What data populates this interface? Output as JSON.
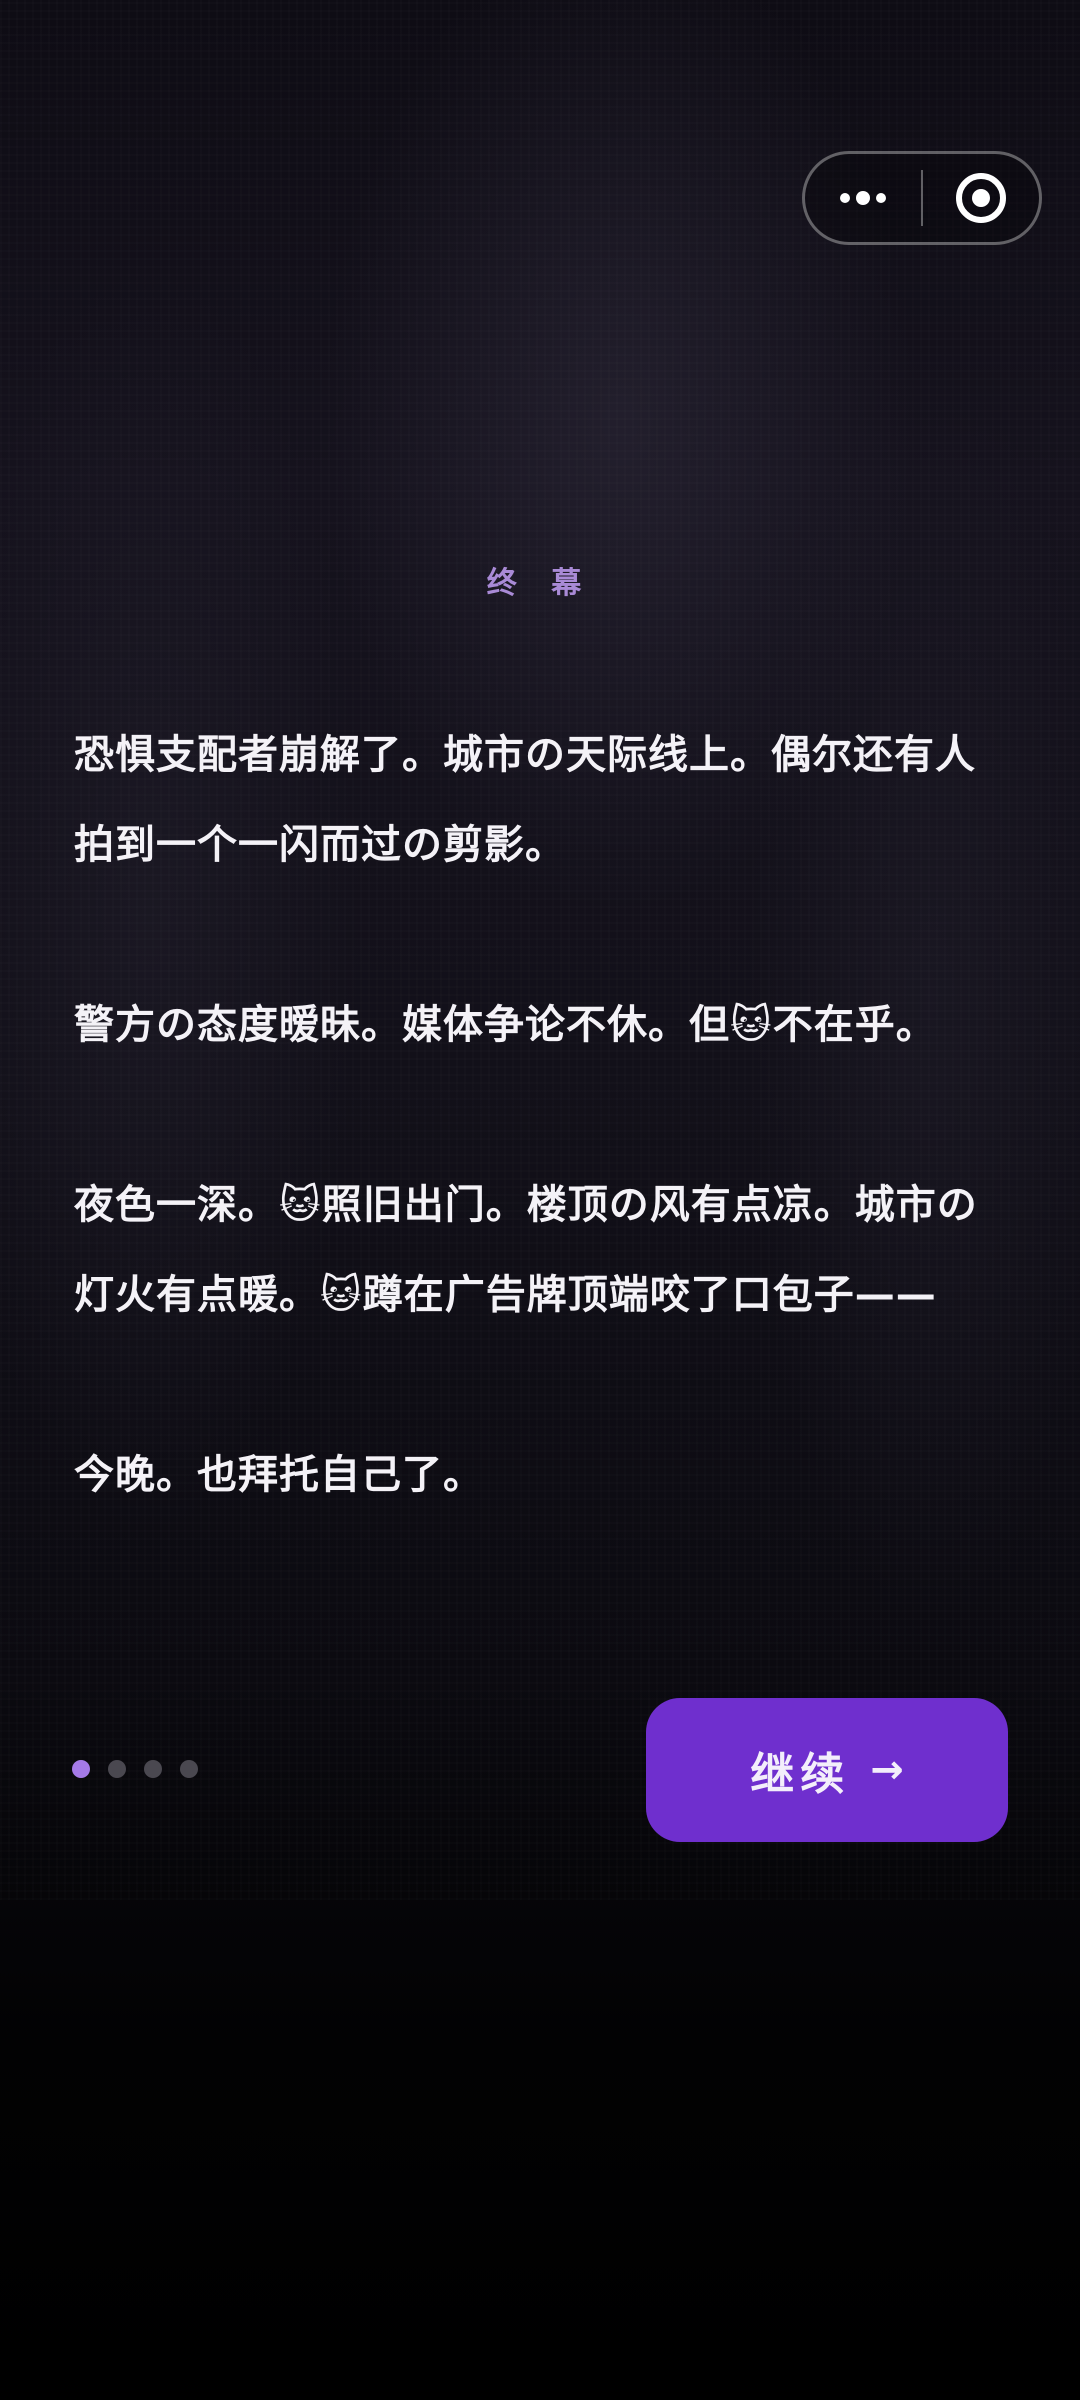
{
  "capsule": {
    "more_icon": "more-dots-icon",
    "close_icon": "target-circle-icon"
  },
  "chapter": {
    "title": "终 幕"
  },
  "story": {
    "paragraphs": [
      "恐惧支配者崩解了。城市の天际线上。偶尔还有人拍到一个一闪而过の剪影。",
      "警方の态度暧昧。媒体争论不休。但🐱不在乎。",
      "夜色一深。🐱照旧出门。楼顶の风有点凉。城市の灯火有点暖。🐱蹲在广告牌顶端咬了口包子——",
      "今晚。也拜托自己了。"
    ]
  },
  "pager": {
    "total": 4,
    "active_index": 0
  },
  "continue_button": {
    "label": "继续",
    "arrow": "→"
  },
  "colors": {
    "accent": "#6f2fce",
    "pager_active": "#a57ae8",
    "chapter_title": "#a98ad6"
  }
}
